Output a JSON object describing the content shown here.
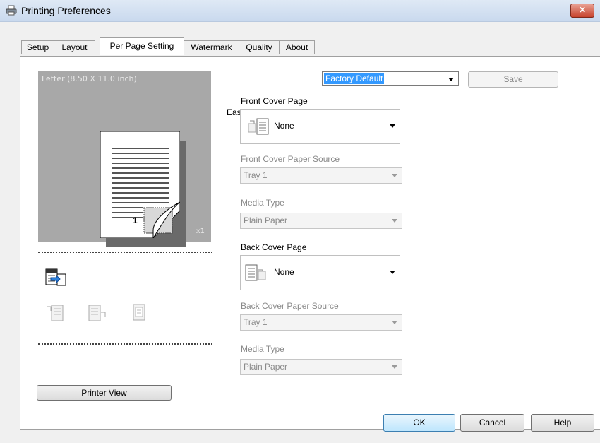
{
  "window": {
    "title": "Printing Preferences",
    "close_label": "✕"
  },
  "tabs": [
    {
      "label": "Setup"
    },
    {
      "label": "Layout"
    },
    {
      "label": "Per Page Setting"
    },
    {
      "label": "Watermark"
    },
    {
      "label": "Quality"
    },
    {
      "label": "About"
    }
  ],
  "active_tab": "Per Page Setting",
  "preview": {
    "paper_label": "Letter  (8.50 X 11.0 inch)",
    "copies": "x1",
    "page_number": "1"
  },
  "printer_view_label": "Printer View",
  "easy_set": {
    "label": "Easy Set",
    "value": "Factory Default",
    "save_label": "Save"
  },
  "front_cover": {
    "label": "Front Cover Page",
    "value": "None",
    "paper_source_label": "Front Cover Paper Source",
    "paper_source_value": "Tray 1",
    "media_type_label": "Media Type",
    "media_type_value": "Plain Paper"
  },
  "back_cover": {
    "label": "Back Cover Page",
    "value": "None",
    "paper_source_label": "Back Cover Paper Source",
    "paper_source_value": "Tray 1",
    "media_type_label": "Media Type",
    "media_type_value": "Plain Paper"
  },
  "buttons": {
    "ok": "OK",
    "cancel": "Cancel",
    "help": "Help"
  },
  "colors": {
    "selection": "#3399ff",
    "close": "#c7432d",
    "preview_bg": "#a8a8a8"
  }
}
